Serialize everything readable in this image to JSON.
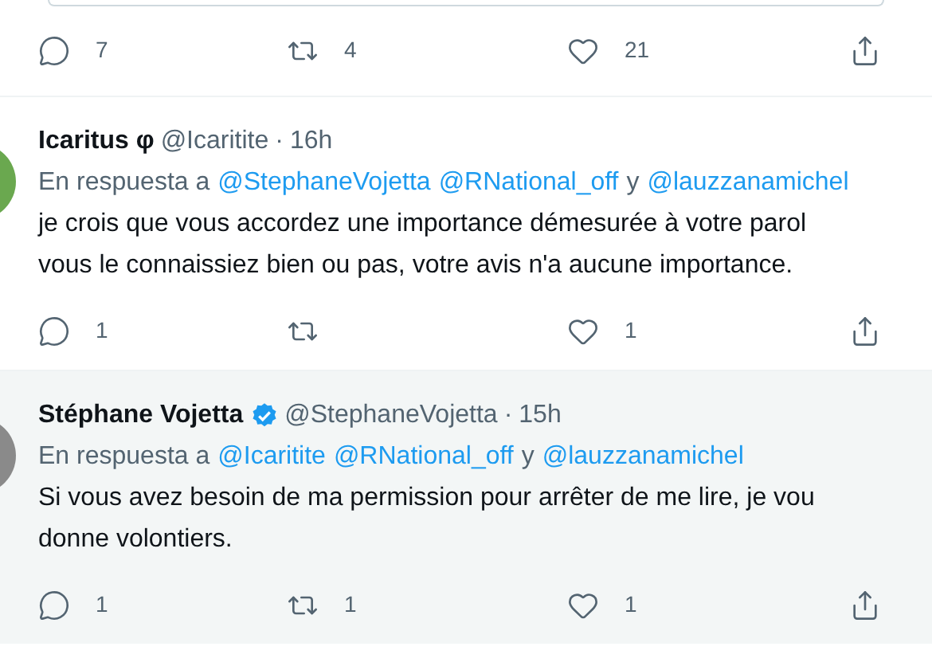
{
  "top_actions": {
    "reply": "7",
    "retweet": "4",
    "like": "21"
  },
  "tweets": [
    {
      "name": "Icaritus φ",
      "verified": false,
      "handle": "@Icaritite",
      "separator": "·",
      "time": "16h",
      "highlighted": false,
      "reply_prefix": "En respuesta a",
      "mentions": [
        "@StephaneVojetta",
        "@RNational_off",
        "@lauzzanamichel"
      ],
      "conjunction": "y",
      "lines": [
        "je crois que vous accordez une importance démesurée à votre parol",
        "vous le connaissiez bien ou pas, votre avis n'a aucune importance."
      ],
      "actions": {
        "reply": "1",
        "like": "1"
      }
    },
    {
      "name": "Stéphane Vojetta",
      "verified": true,
      "handle": "@StephaneVojetta",
      "separator": "·",
      "time": "15h",
      "highlighted": true,
      "reply_prefix": "En respuesta a",
      "mentions": [
        "@Icaritite",
        "@RNational_off",
        "@lauzzanamichel"
      ],
      "conjunction": "y",
      "lines": [
        "Si vous avez besoin de ma permission pour arrêter de me lire, je vou",
        "donne volontiers."
      ],
      "actions": {
        "reply": "1",
        "retweet": "1",
        "like": "1"
      }
    }
  ]
}
